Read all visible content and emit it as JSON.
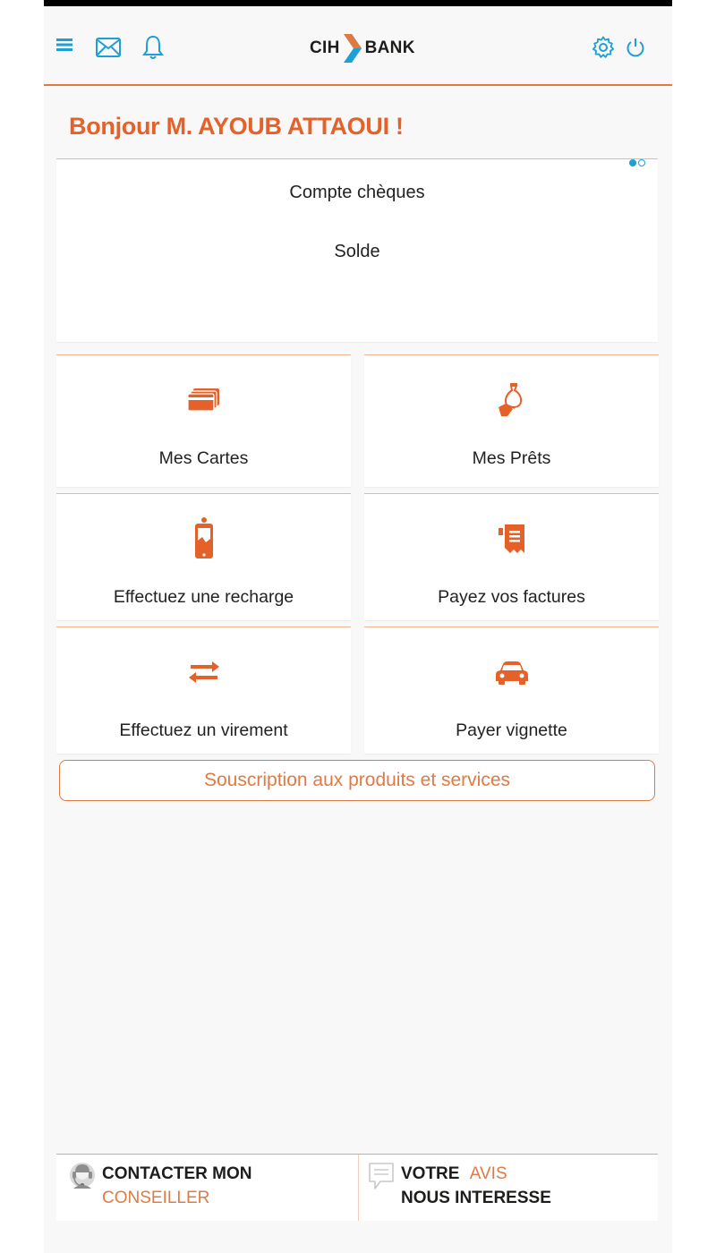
{
  "header": {
    "menu_icon": "hamburger-menu-icon",
    "messages_icon": "envelope-icon",
    "notifications_icon": "bell-icon",
    "logo_left": "CIH",
    "logo_right": "BANK",
    "settings_icon": "gear-icon",
    "logout_icon": "power-icon"
  },
  "greeting": "Bonjour M. AYOUB ATTAOUI !",
  "account_card": {
    "title": "Compte chèques",
    "balance_label": "Solde",
    "pages": 2,
    "active_page": 1
  },
  "tiles": {
    "cards": {
      "label": "Mes Cartes",
      "icon": "credit-cards-icon"
    },
    "loans": {
      "label": "Mes Prêts",
      "icon": "money-bag-hand-icon"
    },
    "recharge": {
      "label": "Effectuez une recharge",
      "icon": "mobile-phone-icon"
    },
    "bills": {
      "label": "Payez vos factures",
      "icon": "invoice-icon"
    },
    "transfer": {
      "label": "Effectuez un virement",
      "icon": "transfer-arrows-icon"
    },
    "vignette": {
      "label": "Payer vignette",
      "icon": "car-icon"
    }
  },
  "subscribe_button": "Souscription aux produits et services",
  "footer": {
    "contact_line1": "CONTACTER MON",
    "contact_line2": "CONSEILLER",
    "opinion_line1_a": "VOTRE",
    "opinion_line1_b": "AVIS",
    "opinion_line2": "NOUS INTERESSE"
  },
  "colors": {
    "accent": "#e07a44",
    "greeting": "#e4612a",
    "header_icons": "#1e9fd6"
  }
}
